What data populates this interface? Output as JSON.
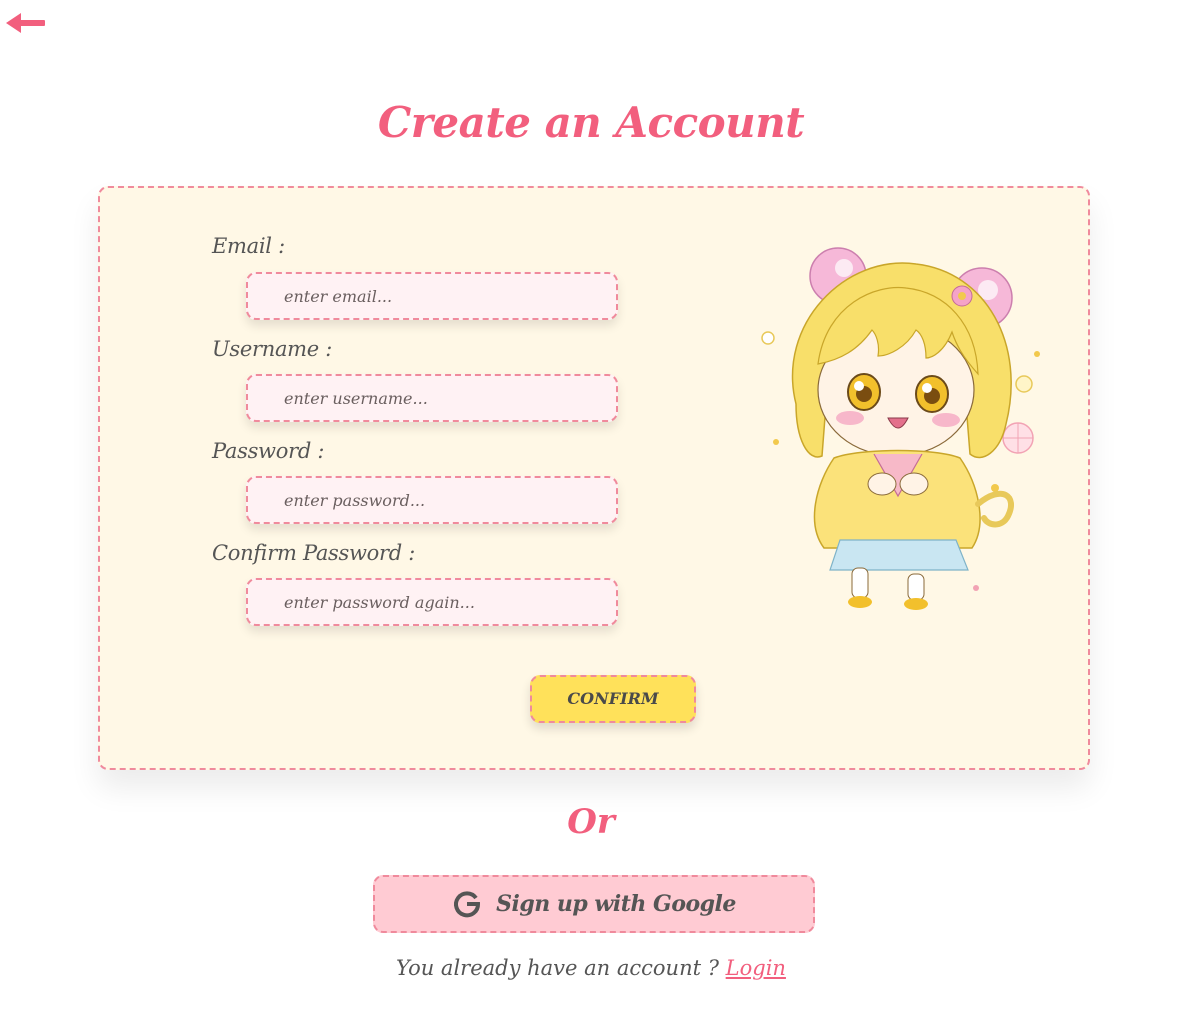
{
  "header": {
    "title": "Create an Account"
  },
  "form": {
    "email": {
      "label": "Email :",
      "placeholder": "enter email..."
    },
    "username": {
      "label": "Username :",
      "placeholder": "enter username..."
    },
    "password": {
      "label": "Password :",
      "placeholder": "enter password..."
    },
    "confirm_password": {
      "label": "Confirm Password :",
      "placeholder": "enter password again..."
    },
    "confirm_label": "CONFIRM"
  },
  "divider": {
    "label": "Or"
  },
  "google": {
    "label": "Sign up with Google"
  },
  "footer": {
    "prompt": "You already have an account ? ",
    "login_label": "Login"
  },
  "colors": {
    "accent": "#f25f7e",
    "card_bg": "#fff8e6",
    "input_bg": "#fff2f4",
    "confirm_bg": "#ffe15a",
    "google_bg": "#ffcbd3",
    "dashed_border": "#f08a9c"
  },
  "icons": {
    "back": "arrow-left-icon",
    "google": "google-g-icon"
  }
}
